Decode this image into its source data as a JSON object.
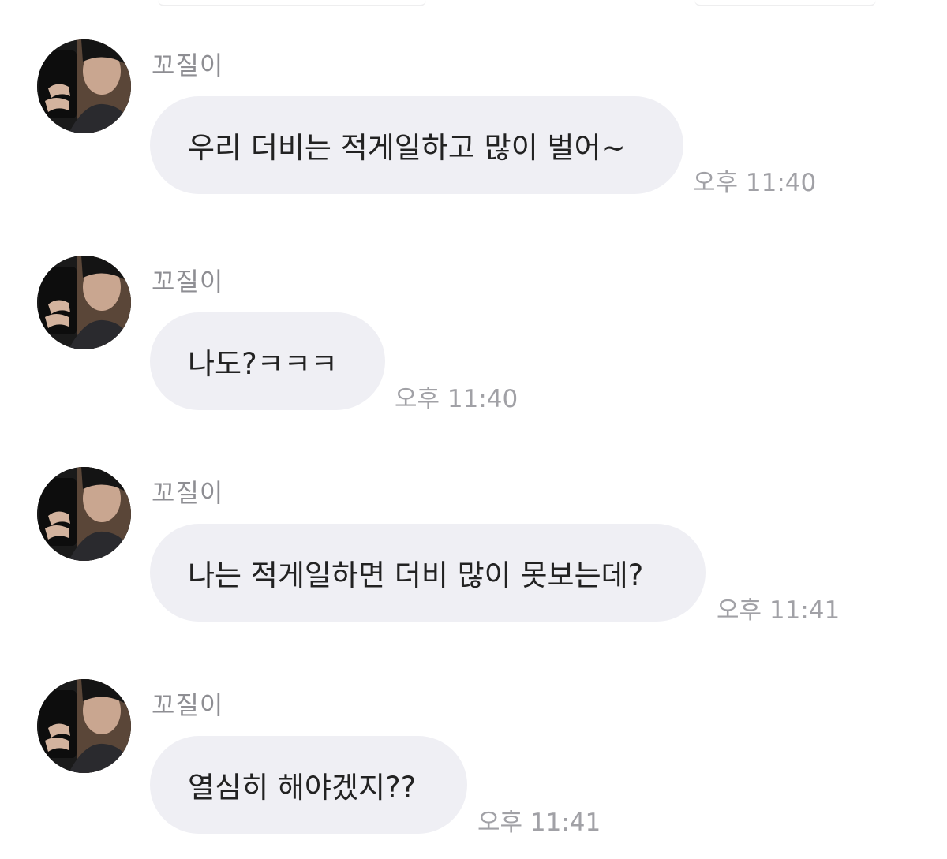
{
  "messages": [
    {
      "sender": "꼬질이",
      "text": "우리 더비는 적게일하고 많이 벌어~",
      "time": "오후 11:40"
    },
    {
      "sender": "꼬질이",
      "text": "나도?ㅋㅋㅋ",
      "time": "오후 11:40"
    },
    {
      "sender": "꼬질이",
      "text": "나는 적게일하면 더비 많이 못보는데?",
      "time": "오후 11:41"
    },
    {
      "sender": "꼬질이",
      "text": "열심히 해야겠지??",
      "time": "오후 11:41"
    }
  ],
  "colors": {
    "bubble": "#efeff4",
    "message_text": "#222222",
    "sender_text": "#8e8e93",
    "time_text": "#a1a1a6"
  },
  "icons": {
    "avatar": "profile-photo"
  }
}
